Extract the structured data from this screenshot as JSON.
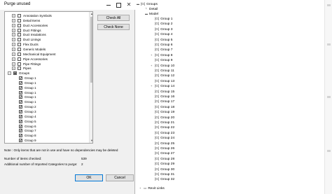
{
  "dialog": {
    "title": "Purge unused",
    "close_glyph": "✕",
    "tree_rows": [
      {
        "label": "Annotation Symbols",
        "level": 1,
        "expander": "+",
        "check": ""
      },
      {
        "label": "Detail Items",
        "level": 1,
        "expander": "+",
        "check": ""
      },
      {
        "label": "Duct Accessories",
        "level": 1,
        "expander": "+",
        "check": ""
      },
      {
        "label": "Duct Fittings",
        "level": 1,
        "expander": "+",
        "check": ""
      },
      {
        "label": "Duct Insulations",
        "level": 1,
        "expander": "+",
        "check": ""
      },
      {
        "label": "Duct Linings",
        "level": 1,
        "expander": "+",
        "check": ""
      },
      {
        "label": "Flex Ducts",
        "level": 1,
        "expander": "+",
        "check": ""
      },
      {
        "label": "Generic Models",
        "level": 1,
        "expander": "+",
        "check": ""
      },
      {
        "label": "Mechanical Equipment",
        "level": 1,
        "expander": "+",
        "check": ""
      },
      {
        "label": "Pipe Accessories",
        "level": 1,
        "expander": "+",
        "check": ""
      },
      {
        "label": "Pipe Fittings",
        "level": 1,
        "expander": "+",
        "check": ""
      },
      {
        "label": "Pipes",
        "level": 1,
        "expander": "+",
        "check": ""
      },
      {
        "label": "Groups",
        "level": 0,
        "expander": "−",
        "check": "■"
      },
      {
        "label": "Group 1",
        "level": 2,
        "expander": "",
        "check": "✔"
      },
      {
        "label": "Group 1",
        "level": 2,
        "expander": "",
        "check": "✔"
      },
      {
        "label": "Group 1",
        "level": 2,
        "expander": "",
        "check": "✔"
      },
      {
        "label": "Group 1",
        "level": 2,
        "expander": "",
        "check": "✔"
      },
      {
        "label": "Group 1",
        "level": 2,
        "expander": "",
        "check": "✔"
      },
      {
        "label": "Group 1",
        "level": 2,
        "expander": "",
        "check": "✔"
      },
      {
        "label": "Group 2",
        "level": 2,
        "expander": "",
        "check": "✔"
      },
      {
        "label": "Group 3",
        "level": 2,
        "expander": "",
        "check": "✔"
      },
      {
        "label": "Group 4",
        "level": 2,
        "expander": "",
        "check": "✔"
      },
      {
        "label": "Group 5",
        "level": 2,
        "expander": "",
        "check": "✔"
      },
      {
        "label": "Group 6",
        "level": 2,
        "expander": "",
        "check": "✔"
      },
      {
        "label": "Group 7",
        "level": 2,
        "expander": "",
        "check": "✔"
      },
      {
        "label": "Group 8",
        "level": 2,
        "expander": "",
        "check": "✔"
      },
      {
        "label": "Group 9",
        "level": 2,
        "expander": "",
        "check": "✔"
      }
    ],
    "check_all_label": "Check All",
    "check_none_label": "Check None",
    "note": "Note : Only items that are not in use and have no dependencies may be deleted",
    "items_checked_label": "Number of items checked:",
    "items_checked_value": "539",
    "imported_label": "Additional number of Imported Categories to purge:",
    "imported_value": "2",
    "ok_label": "OK",
    "cancel_label": "Cancel"
  },
  "browser": {
    "groups_label": "Groups",
    "detail_label": "Detail",
    "model_label": "Model",
    "groups": [
      {
        "label": "Group 1",
        "expandable": false
      },
      {
        "label": "Group 2",
        "expandable": false
      },
      {
        "label": "Group 3",
        "expandable": false
      },
      {
        "label": "Group 4",
        "expandable": false
      },
      {
        "label": "Group 5",
        "expandable": false
      },
      {
        "label": "Group 6",
        "expandable": false
      },
      {
        "label": "Group 7",
        "expandable": false
      },
      {
        "label": "Group 8",
        "expandable": true
      },
      {
        "label": "Group 9",
        "expandable": false
      },
      {
        "label": "Group 10",
        "expandable": true
      },
      {
        "label": "Group 11",
        "expandable": false
      },
      {
        "label": "Group 12",
        "expandable": false
      },
      {
        "label": "Group 13",
        "expandable": false
      },
      {
        "label": "Group 14",
        "expandable": true
      },
      {
        "label": "Group 15",
        "expandable": false
      },
      {
        "label": "Group 16",
        "expandable": false
      },
      {
        "label": "Group 17",
        "expandable": false
      },
      {
        "label": "Group 18",
        "expandable": false
      },
      {
        "label": "Group 19",
        "expandable": false
      },
      {
        "label": "Group 20",
        "expandable": false
      },
      {
        "label": "Group 21",
        "expandable": false
      },
      {
        "label": "Group 22",
        "expandable": false
      },
      {
        "label": "Group 23",
        "expandable": false
      },
      {
        "label": "Group 24",
        "expandable": false
      },
      {
        "label": "Group 25",
        "expandable": false
      },
      {
        "label": "Group 26",
        "expandable": false
      },
      {
        "label": "Group 27",
        "expandable": false
      },
      {
        "label": "Group 28",
        "expandable": false
      },
      {
        "label": "Group 29",
        "expandable": false
      },
      {
        "label": "Group 30",
        "expandable": false
      },
      {
        "label": "Group 31",
        "expandable": false
      },
      {
        "label": "Group 32",
        "expandable": false
      }
    ],
    "revit_links_label": "Revit Links"
  }
}
